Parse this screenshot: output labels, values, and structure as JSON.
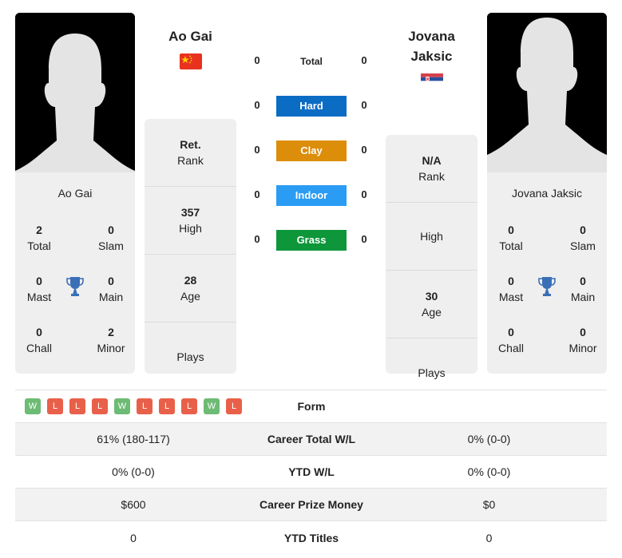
{
  "colors": {
    "hard": "#0b6cc4",
    "clay": "#dc8d09",
    "indoor": "#2a9cf4",
    "grass": "#0e963b",
    "win": "#6dbb74",
    "loss": "#e9604a",
    "trophy": "#3a6fb8"
  },
  "player1": {
    "name": "Ao Gai",
    "card_name": "Ao Gai",
    "flag": "china-flag",
    "titles": {
      "total": {
        "value": "2",
        "label": "Total"
      },
      "slam": {
        "value": "0",
        "label": "Slam"
      },
      "mast": {
        "value": "0",
        "label": "Mast"
      },
      "main": {
        "value": "0",
        "label": "Main"
      },
      "chall": {
        "value": "0",
        "label": "Chall"
      },
      "minor": {
        "value": "2",
        "label": "Minor"
      }
    },
    "info": {
      "rank": {
        "value": "Ret.",
        "label": "Rank"
      },
      "high": {
        "value": "357",
        "label": "High"
      },
      "age": {
        "value": "28",
        "label": "Age"
      },
      "plays": {
        "value": "",
        "label": "Plays"
      }
    }
  },
  "player2": {
    "name": "Jovana Jaksic",
    "name_line1": "Jovana",
    "name_line2": "Jaksic",
    "card_name": "Jovana Jaksic",
    "flag": "serbia-flag",
    "titles": {
      "total": {
        "value": "0",
        "label": "Total"
      },
      "slam": {
        "value": "0",
        "label": "Slam"
      },
      "mast": {
        "value": "0",
        "label": "Mast"
      },
      "main": {
        "value": "0",
        "label": "Main"
      },
      "chall": {
        "value": "0",
        "label": "Chall"
      },
      "minor": {
        "value": "0",
        "label": "Minor"
      }
    },
    "info": {
      "rank": {
        "value": "N/A",
        "label": "Rank"
      },
      "high": {
        "value": "",
        "label": "High"
      },
      "age": {
        "value": "30",
        "label": "Age"
      },
      "plays": {
        "value": "",
        "label": "Plays"
      }
    }
  },
  "h2h": {
    "total": {
      "label": "Total",
      "p1": "0",
      "p2": "0"
    },
    "hard": {
      "label": "Hard",
      "p1": "0",
      "p2": "0"
    },
    "clay": {
      "label": "Clay",
      "p1": "0",
      "p2": "0"
    },
    "indoor": {
      "label": "Indoor",
      "p1": "0",
      "p2": "0"
    },
    "grass": {
      "label": "Grass",
      "p1": "0",
      "p2": "0"
    }
  },
  "comparison": {
    "form": {
      "label": "Form",
      "p1": [
        "W",
        "L",
        "L",
        "L",
        "W",
        "L",
        "L",
        "L",
        "W",
        "L"
      ]
    },
    "rows": [
      {
        "label": "Career Total W/L",
        "p1": "61% (180-117)",
        "p2": "0% (0-0)"
      },
      {
        "label": "YTD W/L",
        "p1": "0% (0-0)",
        "p2": "0% (0-0)"
      },
      {
        "label": "Career Prize Money",
        "p1": "$600",
        "p2": "$0"
      },
      {
        "label": "YTD Titles",
        "p1": "0",
        "p2": "0"
      }
    ]
  }
}
